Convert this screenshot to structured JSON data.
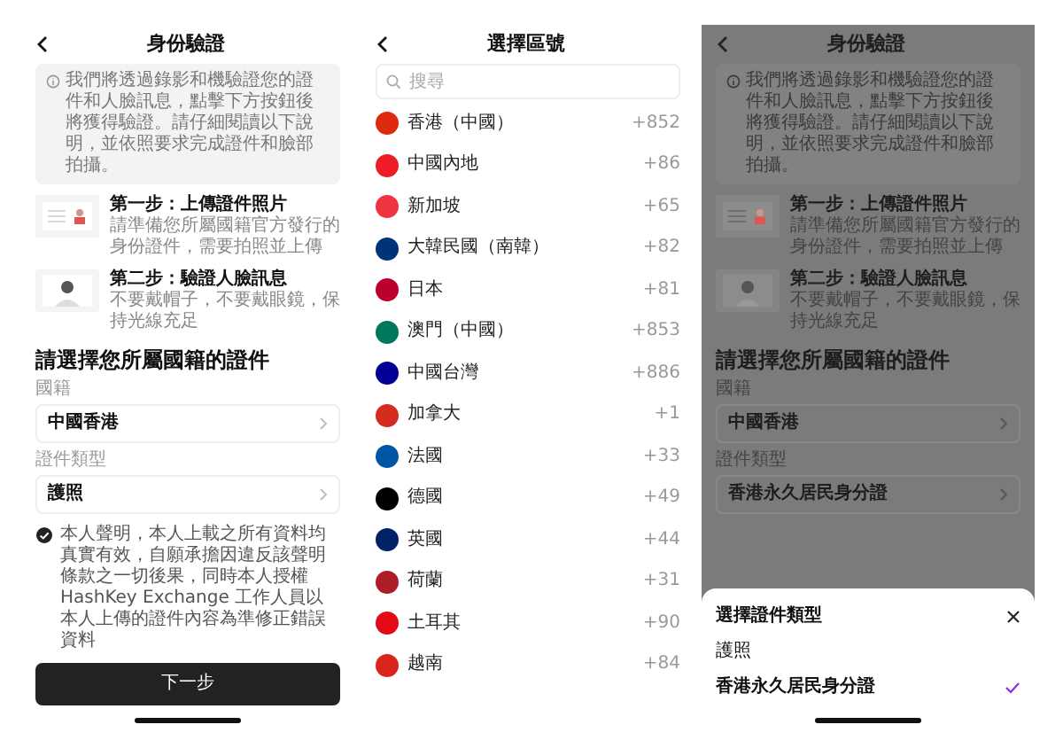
{
  "screens": [
    {
      "kind": "verification",
      "dimmed": false,
      "title": "身份驗證",
      "notice": "我們將透過錄影和機驗證您的證件和人臉訊息，點擊下方按鈕後將獲得驗證。請仔細閱讀以下說明，並依照要求完成證件和臉部拍攝。",
      "steps": [
        {
          "kind": "document",
          "title": "第一步：上傳證件照片",
          "description": "請準備您所屬國籍官方發行的身份證件，需要拍照並上傳"
        },
        {
          "kind": "face",
          "title": "第二步：驗證人臉訊息",
          "description": "不要戴帽子，不要戴眼鏡，保持光線充足"
        }
      ],
      "heading": "請選擇您所屬國籍的證件",
      "fields": [
        {
          "label": "國籍",
          "value": "中國香港"
        },
        {
          "label": "證件類型",
          "value": "護照"
        }
      ],
      "declaration": {
        "checked": true,
        "text": "本人聲明，本人上載之所有資料均真實有效，自願承擔因違反該聲明條款之一切後果，同時本人授權 HashKey Exchange 工作人員以本人上傳的證件內容為準修正錯誤資料"
      },
      "button": "下一步"
    },
    {
      "kind": "region_list",
      "title": "選擇區號",
      "search": {
        "placeholder": "搜尋"
      },
      "regions": [
        {
          "name": "香港（中國）",
          "code": "+852",
          "color": "#de2910"
        },
        {
          "name": "中國內地",
          "code": "+86",
          "color": "#ee1c25"
        },
        {
          "name": "新加坡",
          "code": "+65",
          "color": "#ef3340"
        },
        {
          "name": "大韓民國（南韓）",
          "code": "+82",
          "color": "#003478"
        },
        {
          "name": "日本",
          "code": "+81",
          "color": "#bc002d"
        },
        {
          "name": "澳門（中國）",
          "code": "+853",
          "color": "#00785e"
        },
        {
          "name": "中國台灣",
          "code": "+886",
          "color": "#000095"
        },
        {
          "name": "加拿大",
          "code": "+1",
          "color": "#d52b1e"
        },
        {
          "name": "法國",
          "code": "+33",
          "color": "#0055a4"
        },
        {
          "name": "德國",
          "code": "+49",
          "color": "#000000"
        },
        {
          "name": "英國",
          "code": "+44",
          "color": "#012169"
        },
        {
          "name": "荷蘭",
          "code": "+31",
          "color": "#ae1c28"
        },
        {
          "name": "土耳其",
          "code": "+90",
          "color": "#e30a17"
        },
        {
          "name": "越南",
          "code": "+84",
          "color": "#da251d"
        }
      ]
    },
    {
      "kind": "verification",
      "dimmed": true,
      "title": "身份驗證",
      "notice": "我們將透過錄影和機驗證您的證件和人臉訊息，點擊下方按鈕後將獲得驗證。請仔細閱讀以下說明，並依照要求完成證件和臉部拍攝。",
      "steps": [
        {
          "kind": "document",
          "title": "第一步：上傳證件照片",
          "description": "請準備您所屬國籍官方發行的身份證件，需要拍照並上傳"
        },
        {
          "kind": "face",
          "title": "第二步：驗證人臉訊息",
          "description": "不要戴帽子，不要戴眼鏡，保持光線充足"
        }
      ],
      "heading": "請選擇您所屬國籍的證件",
      "fields": [
        {
          "label": "國籍",
          "value": "中國香港"
        },
        {
          "label": "證件類型",
          "value": "香港永久居民身分證"
        }
      ],
      "sheet": {
        "title": "選擇證件類型",
        "options": [
          {
            "label": "護照",
            "selected": false
          },
          {
            "label": "香港永久居民身分證",
            "selected": true
          }
        ]
      }
    }
  ]
}
